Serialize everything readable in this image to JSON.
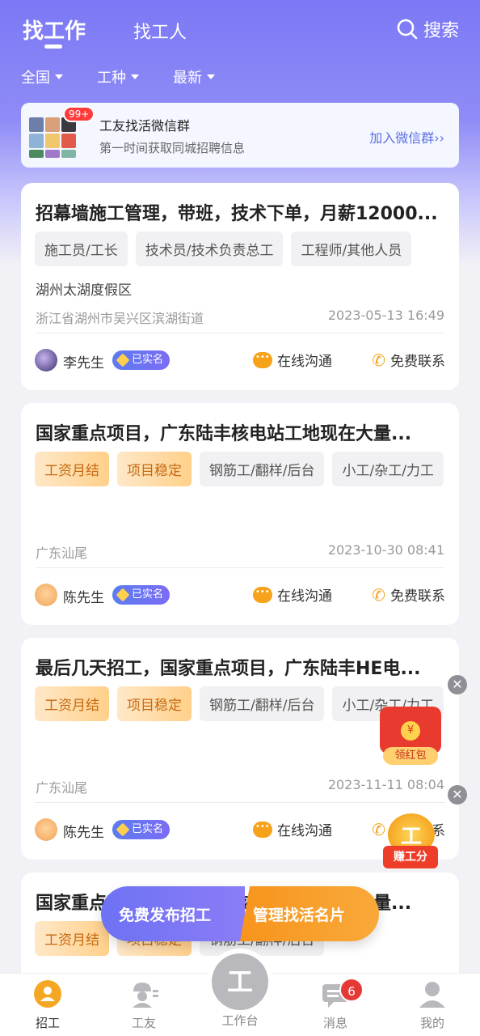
{
  "header": {
    "tab_find_job": "找工作",
    "tab_find_worker": "找工人",
    "search_label": "搜索"
  },
  "filters": [
    {
      "label": "全国"
    },
    {
      "label": "工种"
    },
    {
      "label": "最新"
    }
  ],
  "banner": {
    "badge": "99+",
    "title": "工友找活微信群",
    "subtitle": "第一时间获取同城招聘信息",
    "link": "加入微信群"
  },
  "jobs": [
    {
      "title": "招幕墙施工管理，带班，技术下单，月薪12000...",
      "tags": [
        "施工员/工长",
        "技术员/技术负责总工",
        "工程师/其他人员"
      ],
      "location": "湖州太湖度假区",
      "address": "浙江省湖州市吴兴区滨湖街道",
      "time": "2023-05-13 16:49",
      "poster": "李先生",
      "verified": "已实名",
      "chat": "在线沟通",
      "call": "免费联系"
    },
    {
      "title": "国家重点项目，广东陆丰核电站工地现在大量...",
      "tags": [
        "工资月结",
        "项目稳定",
        "钢筋工/翻样/后台",
        "小工/杂工/力工"
      ],
      "location": "广东汕尾",
      "time": "2023-10-30 08:41",
      "poster": "陈先生",
      "verified": "已实名",
      "chat": "在线沟通",
      "call": "免费联系"
    },
    {
      "title": "最后几天招工，国家重点项目，广东陆丰HE电...",
      "tags": [
        "工资月结",
        "项目稳定",
        "钢筋工/翻样/后台",
        "小工/杂工/力工"
      ],
      "location": "广东汕尾",
      "time": "2023-11-11 08:04",
      "poster": "陈先生",
      "verified": "已实名",
      "chat": "在线沟通",
      "call": "免费联系"
    },
    {
      "title": "国家重点项目，广东陆丰核电站工地现在大量...",
      "tags": [
        "工资月结",
        "项目稳定",
        "钢筋工/翻样/后台"
      ]
    }
  ],
  "floats": {
    "redpack": "领红包",
    "earn": "赚工分",
    "earn_glyph": "工"
  },
  "cta": {
    "post_job": "免费发布招工",
    "manage_card": "管理找活名片"
  },
  "tabbar": {
    "recruit": "招工",
    "workers": "工友",
    "workbench": "工作台",
    "workbench_glyph": "工",
    "messages": "消息",
    "messages_badge": "6",
    "mine": "我的"
  }
}
